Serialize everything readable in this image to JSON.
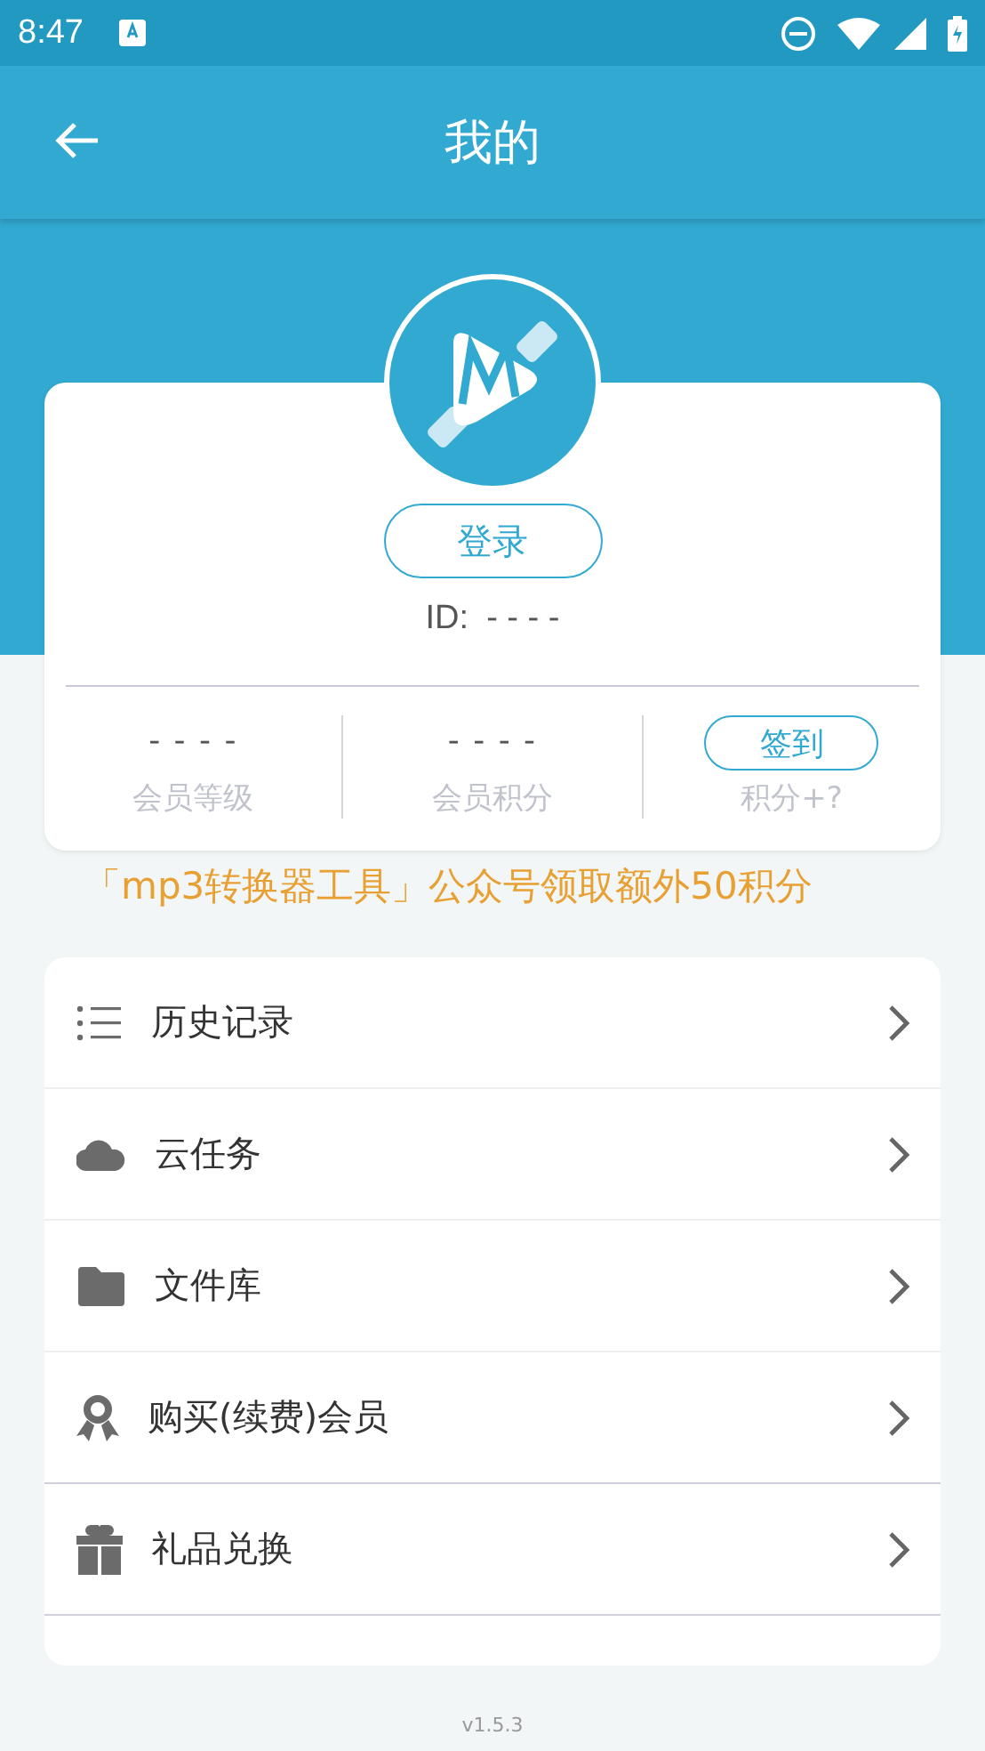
{
  "status_bar": {
    "time": "8:47"
  },
  "app_bar": {
    "title": "我的"
  },
  "profile": {
    "login_button": "登录",
    "id_label": "ID:",
    "id_value": "- - - -"
  },
  "stats": [
    {
      "kind": "value",
      "value": "- - - -",
      "label": "会员等级"
    },
    {
      "kind": "value",
      "value": "- - - -",
      "label": "会员积分"
    },
    {
      "kind": "action",
      "button": "签到",
      "label": "积分+?"
    }
  ],
  "marquee": "「mp3转换器工具」公众号领取额外50积分",
  "menu": [
    {
      "kind": "list",
      "label": "历史记录"
    },
    {
      "kind": "cloud",
      "label": "云任务"
    },
    {
      "kind": "folder",
      "label": "文件库"
    },
    {
      "kind": "award",
      "label": "购买(续费)会员"
    },
    {
      "kind": "gift",
      "label": "礼品兑换"
    }
  ],
  "version": "v1.5.3"
}
